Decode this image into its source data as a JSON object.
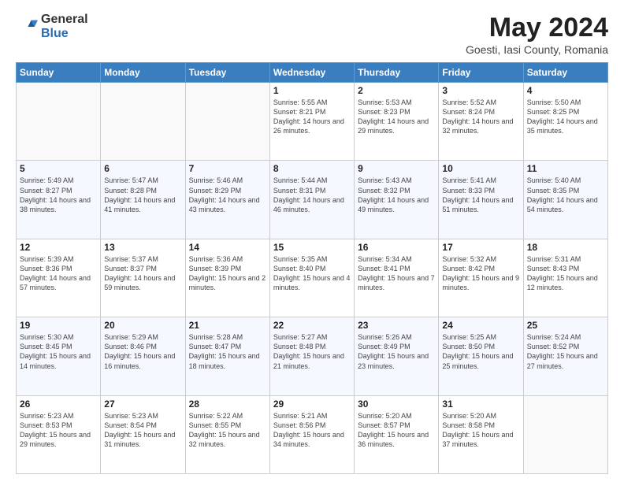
{
  "header": {
    "logo_general": "General",
    "logo_blue": "Blue",
    "main_title": "May 2024",
    "subtitle": "Goesti, Iasi County, Romania"
  },
  "weekdays": [
    "Sunday",
    "Monday",
    "Tuesday",
    "Wednesday",
    "Thursday",
    "Friday",
    "Saturday"
  ],
  "weeks": [
    [
      {
        "day": "",
        "info": ""
      },
      {
        "day": "",
        "info": ""
      },
      {
        "day": "",
        "info": ""
      },
      {
        "day": "1",
        "info": "Sunrise: 5:55 AM\nSunset: 8:21 PM\nDaylight: 14 hours and 26 minutes."
      },
      {
        "day": "2",
        "info": "Sunrise: 5:53 AM\nSunset: 8:23 PM\nDaylight: 14 hours and 29 minutes."
      },
      {
        "day": "3",
        "info": "Sunrise: 5:52 AM\nSunset: 8:24 PM\nDaylight: 14 hours and 32 minutes."
      },
      {
        "day": "4",
        "info": "Sunrise: 5:50 AM\nSunset: 8:25 PM\nDaylight: 14 hours and 35 minutes."
      }
    ],
    [
      {
        "day": "5",
        "info": "Sunrise: 5:49 AM\nSunset: 8:27 PM\nDaylight: 14 hours and 38 minutes."
      },
      {
        "day": "6",
        "info": "Sunrise: 5:47 AM\nSunset: 8:28 PM\nDaylight: 14 hours and 41 minutes."
      },
      {
        "day": "7",
        "info": "Sunrise: 5:46 AM\nSunset: 8:29 PM\nDaylight: 14 hours and 43 minutes."
      },
      {
        "day": "8",
        "info": "Sunrise: 5:44 AM\nSunset: 8:31 PM\nDaylight: 14 hours and 46 minutes."
      },
      {
        "day": "9",
        "info": "Sunrise: 5:43 AM\nSunset: 8:32 PM\nDaylight: 14 hours and 49 minutes."
      },
      {
        "day": "10",
        "info": "Sunrise: 5:41 AM\nSunset: 8:33 PM\nDaylight: 14 hours and 51 minutes."
      },
      {
        "day": "11",
        "info": "Sunrise: 5:40 AM\nSunset: 8:35 PM\nDaylight: 14 hours and 54 minutes."
      }
    ],
    [
      {
        "day": "12",
        "info": "Sunrise: 5:39 AM\nSunset: 8:36 PM\nDaylight: 14 hours and 57 minutes."
      },
      {
        "day": "13",
        "info": "Sunrise: 5:37 AM\nSunset: 8:37 PM\nDaylight: 14 hours and 59 minutes."
      },
      {
        "day": "14",
        "info": "Sunrise: 5:36 AM\nSunset: 8:39 PM\nDaylight: 15 hours and 2 minutes."
      },
      {
        "day": "15",
        "info": "Sunrise: 5:35 AM\nSunset: 8:40 PM\nDaylight: 15 hours and 4 minutes."
      },
      {
        "day": "16",
        "info": "Sunrise: 5:34 AM\nSunset: 8:41 PM\nDaylight: 15 hours and 7 minutes."
      },
      {
        "day": "17",
        "info": "Sunrise: 5:32 AM\nSunset: 8:42 PM\nDaylight: 15 hours and 9 minutes."
      },
      {
        "day": "18",
        "info": "Sunrise: 5:31 AM\nSunset: 8:43 PM\nDaylight: 15 hours and 12 minutes."
      }
    ],
    [
      {
        "day": "19",
        "info": "Sunrise: 5:30 AM\nSunset: 8:45 PM\nDaylight: 15 hours and 14 minutes."
      },
      {
        "day": "20",
        "info": "Sunrise: 5:29 AM\nSunset: 8:46 PM\nDaylight: 15 hours and 16 minutes."
      },
      {
        "day": "21",
        "info": "Sunrise: 5:28 AM\nSunset: 8:47 PM\nDaylight: 15 hours and 18 minutes."
      },
      {
        "day": "22",
        "info": "Sunrise: 5:27 AM\nSunset: 8:48 PM\nDaylight: 15 hours and 21 minutes."
      },
      {
        "day": "23",
        "info": "Sunrise: 5:26 AM\nSunset: 8:49 PM\nDaylight: 15 hours and 23 minutes."
      },
      {
        "day": "24",
        "info": "Sunrise: 5:25 AM\nSunset: 8:50 PM\nDaylight: 15 hours and 25 minutes."
      },
      {
        "day": "25",
        "info": "Sunrise: 5:24 AM\nSunset: 8:52 PM\nDaylight: 15 hours and 27 minutes."
      }
    ],
    [
      {
        "day": "26",
        "info": "Sunrise: 5:23 AM\nSunset: 8:53 PM\nDaylight: 15 hours and 29 minutes."
      },
      {
        "day": "27",
        "info": "Sunrise: 5:23 AM\nSunset: 8:54 PM\nDaylight: 15 hours and 31 minutes."
      },
      {
        "day": "28",
        "info": "Sunrise: 5:22 AM\nSunset: 8:55 PM\nDaylight: 15 hours and 32 minutes."
      },
      {
        "day": "29",
        "info": "Sunrise: 5:21 AM\nSunset: 8:56 PM\nDaylight: 15 hours and 34 minutes."
      },
      {
        "day": "30",
        "info": "Sunrise: 5:20 AM\nSunset: 8:57 PM\nDaylight: 15 hours and 36 minutes."
      },
      {
        "day": "31",
        "info": "Sunrise: 5:20 AM\nSunset: 8:58 PM\nDaylight: 15 hours and 37 minutes."
      },
      {
        "day": "",
        "info": ""
      }
    ]
  ]
}
